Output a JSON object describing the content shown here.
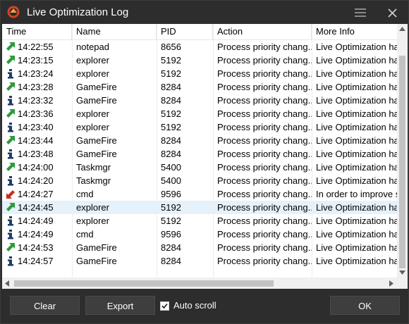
{
  "window": {
    "title": "Live Optimization Log"
  },
  "columns": {
    "time": "Time",
    "name": "Name",
    "pid": "PID",
    "action": "Action",
    "info": "More Info"
  },
  "rows": [
    {
      "icon": "green-arrow-icon",
      "time": "14:22:55",
      "name": "notepad",
      "pid": "8656",
      "action": "Process priority chang...",
      "info": "Live Optimization has"
    },
    {
      "icon": "green-arrow-icon",
      "time": "14:23:15",
      "name": "explorer",
      "pid": "5192",
      "action": "Process priority chang...",
      "info": "Live Optimization has"
    },
    {
      "icon": "info-icon",
      "time": "14:23:24",
      "name": "explorer",
      "pid": "5192",
      "action": "Process priority chang...",
      "info": "Live Optimization has"
    },
    {
      "icon": "green-arrow-icon",
      "time": "14:23:28",
      "name": "GameFire",
      "pid": "8284",
      "action": "Process priority chang...",
      "info": "Live Optimization has"
    },
    {
      "icon": "info-icon",
      "time": "14:23:32",
      "name": "GameFire",
      "pid": "8284",
      "action": "Process priority chang...",
      "info": "Live Optimization has"
    },
    {
      "icon": "green-arrow-icon",
      "time": "14:23:36",
      "name": "explorer",
      "pid": "5192",
      "action": "Process priority chang...",
      "info": "Live Optimization has"
    },
    {
      "icon": "info-icon",
      "time": "14:23:40",
      "name": "explorer",
      "pid": "5192",
      "action": "Process priority chang...",
      "info": "Live Optimization has"
    },
    {
      "icon": "green-arrow-icon",
      "time": "14:23:44",
      "name": "GameFire",
      "pid": "8284",
      "action": "Process priority chang...",
      "info": "Live Optimization has"
    },
    {
      "icon": "info-icon",
      "time": "14:23:48",
      "name": "GameFire",
      "pid": "8284",
      "action": "Process priority chang...",
      "info": "Live Optimization has"
    },
    {
      "icon": "green-arrow-icon",
      "time": "14:24:00",
      "name": "Taskmgr",
      "pid": "5400",
      "action": "Process priority chang...",
      "info": "Live Optimization has"
    },
    {
      "icon": "info-icon",
      "time": "14:24:20",
      "name": "Taskmgr",
      "pid": "5400",
      "action": "Process priority chang...",
      "info": "Live Optimization has"
    },
    {
      "icon": "red-arrow-icon",
      "time": "14:24:27",
      "name": "cmd",
      "pid": "9596",
      "action": "Process priority chang...",
      "info": "In order to improve sy"
    },
    {
      "icon": "green-arrow-icon",
      "time": "14:24:45",
      "name": "explorer",
      "pid": "5192",
      "action": "Process priority chang...",
      "info": "Live Optimization has",
      "selected": true
    },
    {
      "icon": "info-icon",
      "time": "14:24:49",
      "name": "explorer",
      "pid": "5192",
      "action": "Process priority chang...",
      "info": "Live Optimization has"
    },
    {
      "icon": "info-icon",
      "time": "14:24:49",
      "name": "cmd",
      "pid": "9596",
      "action": "Process priority chang...",
      "info": "Live Optimization has"
    },
    {
      "icon": "green-arrow-icon",
      "time": "14:24:53",
      "name": "GameFire",
      "pid": "8284",
      "action": "Process priority chang...",
      "info": "Live Optimization has"
    },
    {
      "icon": "info-icon",
      "time": "14:24:57",
      "name": "GameFire",
      "pid": "8284",
      "action": "Process priority chang...",
      "info": "Live Optimization has"
    }
  ],
  "footer": {
    "clear_label": "Clear",
    "export_label": "Export",
    "autoscroll_label": "Auto scroll",
    "autoscroll_checked": true,
    "ok_label": "OK"
  },
  "colors": {
    "green": "#2e9a3c",
    "red": "#d0281e",
    "info": "#1f3a66",
    "selected_row": "#e5f1fb"
  }
}
